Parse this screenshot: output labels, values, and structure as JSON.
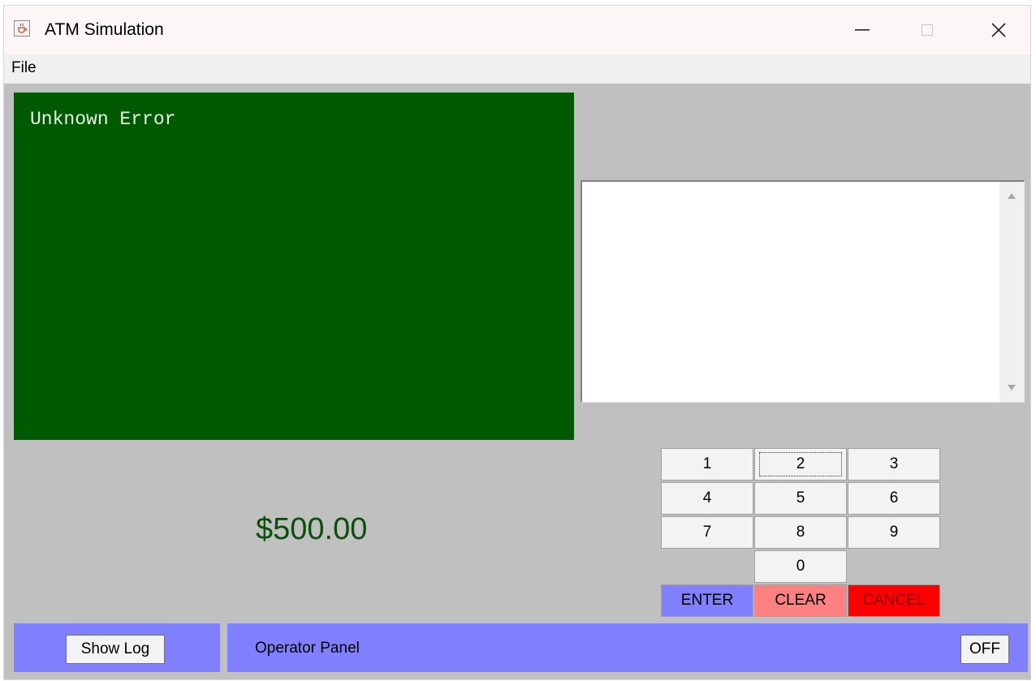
{
  "window": {
    "title": "ATM Simulation",
    "icon": "java-coffee-cup-icon"
  },
  "menu": {
    "file": "File"
  },
  "display": {
    "message": "Unknown Error",
    "background": "#005a00"
  },
  "cash_dispenser": {
    "amount": "$500.00"
  },
  "keypad": {
    "keys": [
      "1",
      "2",
      "3",
      "4",
      "5",
      "6",
      "7",
      "8",
      "9",
      "0"
    ],
    "enter": "ENTER",
    "clear": "CLEAR",
    "cancel": "CANCEL",
    "colors": {
      "enter": "#8080ff",
      "clear": "#ff8080",
      "cancel": "#ff0000"
    }
  },
  "log": {
    "button": "Show Log"
  },
  "operator_panel": {
    "label": "Operator Panel",
    "button": "OFF",
    "color": "#8080ff"
  }
}
